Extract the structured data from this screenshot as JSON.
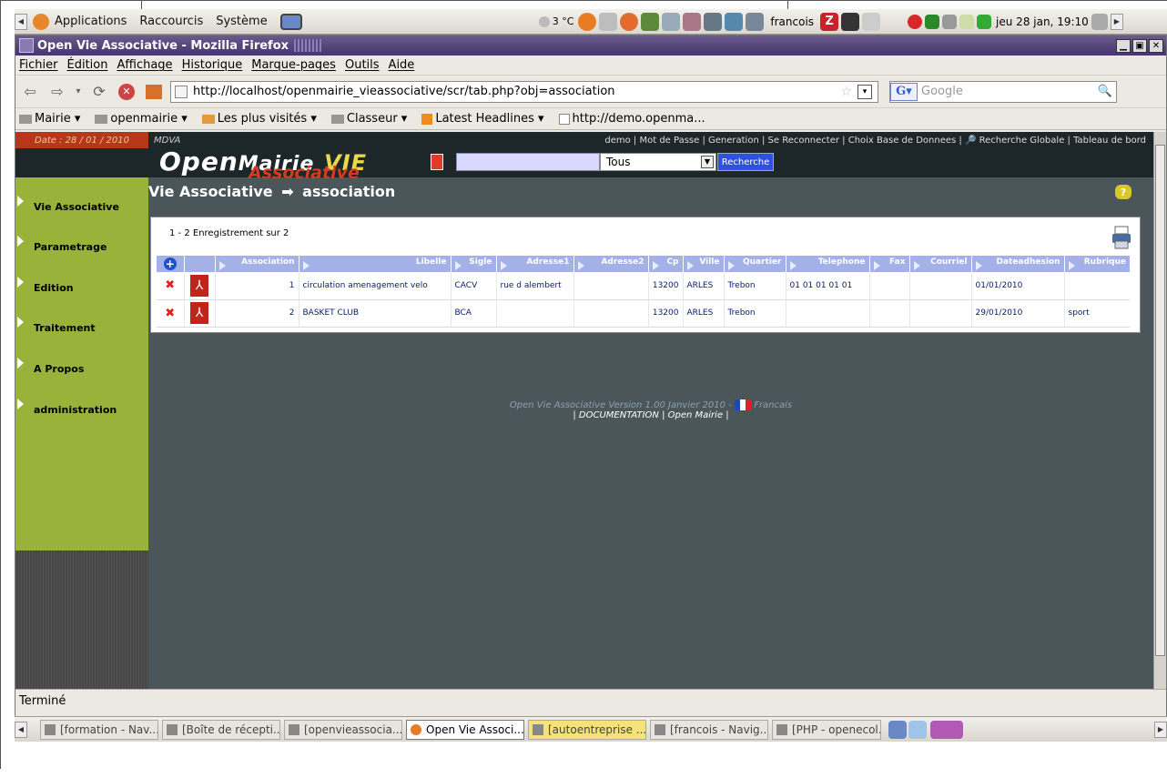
{
  "panel": {
    "menus": [
      "Applications",
      "Raccourcis",
      "Système"
    ],
    "weather": "3 °C",
    "user": "francois",
    "datetime": "jeu 28 jan, 19:10"
  },
  "window": {
    "title": "Open Vie Associative - Mozilla Firefox",
    "menu": [
      "Fichier",
      "Édition",
      "Affichage",
      "Historique",
      "Marque-pages",
      "Outils",
      "Aide"
    ],
    "url": "http://localhost/openmairie_vieassociative/scr/tab.php?obj=association",
    "search_placeholder": "Google",
    "bookmarks": [
      "Mairie ▾",
      "openmairie ▾",
      "Les plus visités ▾",
      "Classeur ▾",
      "Latest Headlines ▾",
      "http://demo.openma..."
    ],
    "status": "Terminé"
  },
  "app": {
    "date": "Date : 28 / 01 / 2010",
    "mdva": "MDVA",
    "toplinks": "demo | Mot de Passe | Generation | Se Reconnecter | Choix Base de Donnees | 🔎 Recherche Globale | Tableau de bord",
    "logo_open": "Open",
    "logo_mairie": "Mairie",
    "logo_vie": "VIE",
    "logo_asso": "Associative",
    "search_select": "Tous",
    "search_button": "Recherche",
    "breadcrumb_root": "Vie Associative",
    "breadcrumb_arrow": "➡",
    "breadcrumb_leaf": "association",
    "sidebar": [
      "Vie Associative",
      "Parametrage",
      "Edition",
      "Traitement",
      "A Propos",
      "administration"
    ],
    "record_count": "1 - 2 Enregistrement sur 2",
    "columns": [
      "Association",
      "Libelle",
      "Sigle",
      "Adresse1",
      "Adresse2",
      "Cp",
      "Ville",
      "Quartier",
      "Telephone",
      "Fax",
      "Courriel",
      "Dateadhesion",
      "Rubrique"
    ],
    "rows": [
      [
        "1",
        "circulation amenagement velo",
        "CACV",
        "rue d alembert",
        "",
        "13200",
        "ARLES",
        "Trebon",
        "01 01 01 01 01",
        "",
        "",
        "01/01/2010",
        ""
      ],
      [
        "2",
        "BASKET CLUB",
        "BCA",
        "",
        "",
        "13200",
        "ARLES",
        "Trebon",
        "",
        "",
        "",
        "29/01/2010",
        "sport"
      ]
    ],
    "footer_version": "Open Vie Associative  Version 1.00 Janvier 2010 -",
    "footer_lang": "Francais",
    "footer_links": "| DOCUMENTATION | Open Mairie |"
  },
  "taskbar": [
    "[formation - Nav...",
    "[Boîte de récepti...",
    "[openvieassocia...",
    "Open Vie Associ...",
    "[autoentreprise ...",
    "[francois - Navig...",
    "[PHP - openecol..."
  ]
}
